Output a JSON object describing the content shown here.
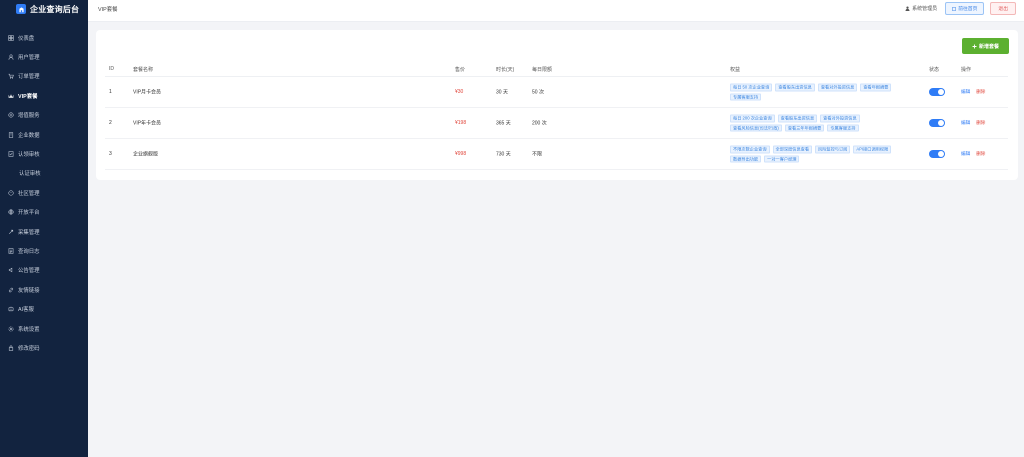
{
  "brand": {
    "title": "企业查询后台"
  },
  "menu": [
    {
      "label": "仪表盘",
      "icon": "dashboard-icon"
    },
    {
      "label": "用户管理",
      "icon": "user-icon"
    },
    {
      "label": "订单管理",
      "icon": "order-icon"
    },
    {
      "label": "VIP套餐",
      "icon": "vip-icon",
      "active": true
    },
    {
      "label": "增值服务",
      "icon": "service-icon"
    },
    {
      "label": "企业数据",
      "icon": "building-icon"
    },
    {
      "label": "认领审核",
      "icon": "audit-icon"
    },
    {
      "label": "认证审核",
      "icon": "",
      "sub": true
    },
    {
      "label": "社区管理",
      "icon": "community-icon"
    },
    {
      "label": "开放平台",
      "icon": "platform-icon"
    },
    {
      "label": "采集管理",
      "icon": "collect-icon"
    },
    {
      "label": "查询日志",
      "icon": "log-icon"
    },
    {
      "label": "公告管理",
      "icon": "notice-icon"
    },
    {
      "label": "友情链接",
      "icon": "link-icon"
    },
    {
      "label": "AI客服",
      "icon": "ai-icon"
    },
    {
      "label": "系统设置",
      "icon": "settings-icon"
    },
    {
      "label": "修改密码",
      "icon": "lock-icon"
    }
  ],
  "header": {
    "breadcrumb": "VIP套餐",
    "admin_label": "系统管理员",
    "front_label": "前往首页",
    "logout_label": "退出"
  },
  "toolbar": {
    "add_label": "新增套餐"
  },
  "table": {
    "columns": [
      "ID",
      "套餐名称",
      "售价",
      "时长(天)",
      "每日限额",
      "权益",
      "状态",
      "操作"
    ],
    "rows": [
      {
        "id": "1",
        "name": "VIP月卡会员",
        "price": "¥30",
        "duration": "30 天",
        "daily": "50 次",
        "rights": [
          "每日 50 次企业查询",
          "查看股东出资信息",
          "查看对外投资信息",
          "查看年报摘要",
          "专属客服支持"
        ],
        "enabled": true,
        "edit": "编辑",
        "delete": "删除"
      },
      {
        "id": "2",
        "name": "VIP年卡会员",
        "price": "¥198",
        "duration": "365 天",
        "daily": "200 次",
        "rights": [
          "每日 200 次企业查询",
          "查看股东出资信息",
          "查看对外投资信息",
          "查看风险信息(司法/行政)",
          "查看三年年报摘要",
          "专属客服支持"
        ],
        "enabled": true,
        "edit": "编辑",
        "delete": "删除"
      },
      {
        "id": "3",
        "name": "企业旗舰版",
        "price": "¥998",
        "duration": "730 天",
        "daily": "不限",
        "rights": [
          "不限次数企业查询",
          "全部深度信息查看",
          "风险监控与订阅",
          "API接口调用权限",
          "数据导出功能",
          "一对一客户经理"
        ],
        "enabled": true,
        "edit": "编辑",
        "delete": "删除"
      }
    ]
  },
  "colors": {
    "sidebar": "#12233f",
    "accent": "#2f7cf6",
    "add": "#5cb030",
    "price": "#e0453a"
  }
}
